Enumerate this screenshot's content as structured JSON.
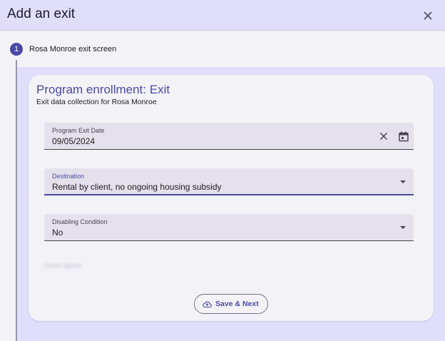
{
  "dialog": {
    "title": "Add an exit"
  },
  "stepper": {
    "step_number": "1",
    "step_label": "Rosa Monroe exit screen"
  },
  "form": {
    "title": "Program enrollment: Exit",
    "subtitle": "Exit data collection for Rosa Monroe",
    "fields": [
      {
        "label": "Program Exit Date",
        "value": "09/05/2024"
      },
      {
        "label": "Destination",
        "value": "Rental by client, no ongoing housing subsidy"
      },
      {
        "label": "Disabling Condition",
        "value": "No"
      }
    ],
    "blurred_text": "Lorem ipsum",
    "save_label": "Save & Next"
  },
  "icons": {
    "close": "close-icon",
    "clear": "clear-icon",
    "calendar": "calendar-icon",
    "dropdown": "dropdown-arrow-icon",
    "cloud_upload": "cloud-upload-icon"
  },
  "colors": {
    "primary": "#4a4aa6",
    "header_bg": "#e0defa",
    "surface": "#f3f2f7",
    "field_bg": "#e4e1ec"
  }
}
